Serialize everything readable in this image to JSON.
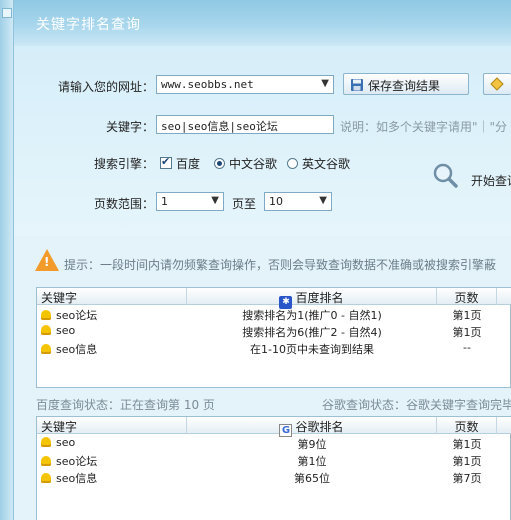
{
  "window": {
    "title": "关键字排名查询"
  },
  "form": {
    "url_label": "请输入您的网址：",
    "url_value": "www.seobbs.net",
    "save_button": "保存查询结果",
    "keyword_label": "关键字：",
    "keyword_value": "seo|seo信息|seo论坛",
    "keyword_hint": "说明：如多个关键字请用\"｜\"分",
    "engine_label": "搜索引擎：",
    "engine_baidu": "百度",
    "engine_google_cn": "中文谷歌",
    "engine_google_en": "英文谷歌",
    "start_button": "开始查询",
    "page_label": "页数范围：",
    "page_from": "1",
    "page_to_label": "页至",
    "page_to": "10"
  },
  "notice": "提示：一段时间内请勿频繁查询操作，否则会导致查询数据不准确或被搜索引擎蔽",
  "baidu_table": {
    "headers": [
      "关键字",
      "百度排名",
      "页数"
    ],
    "rows": [
      [
        "seo论坛",
        "搜索排名为1(推广0 - 自然1)",
        "第1页"
      ],
      [
        "seo",
        "搜索排名为6(推广2 - 自然4)",
        "第1页"
      ],
      [
        "seo信息",
        "在1-10页中未查询到结果",
        "--"
      ]
    ]
  },
  "status": {
    "baidu": "百度查询状态：正在查询第 10 页",
    "google": "谷歌查询状态：谷歌关键字查询完毕"
  },
  "google_table": {
    "headers": [
      "关键字",
      "谷歌排名",
      "页数"
    ],
    "rows": [
      [
        "seo",
        "第9位",
        "第1页"
      ],
      [
        "seo论坛",
        "第1位",
        "第1页"
      ],
      [
        "seo信息",
        "第65位",
        "第7页"
      ]
    ]
  },
  "colors": {
    "accent": "#8fc9e4",
    "background": "#e4f3fa",
    "warning": "#f29b2a"
  }
}
